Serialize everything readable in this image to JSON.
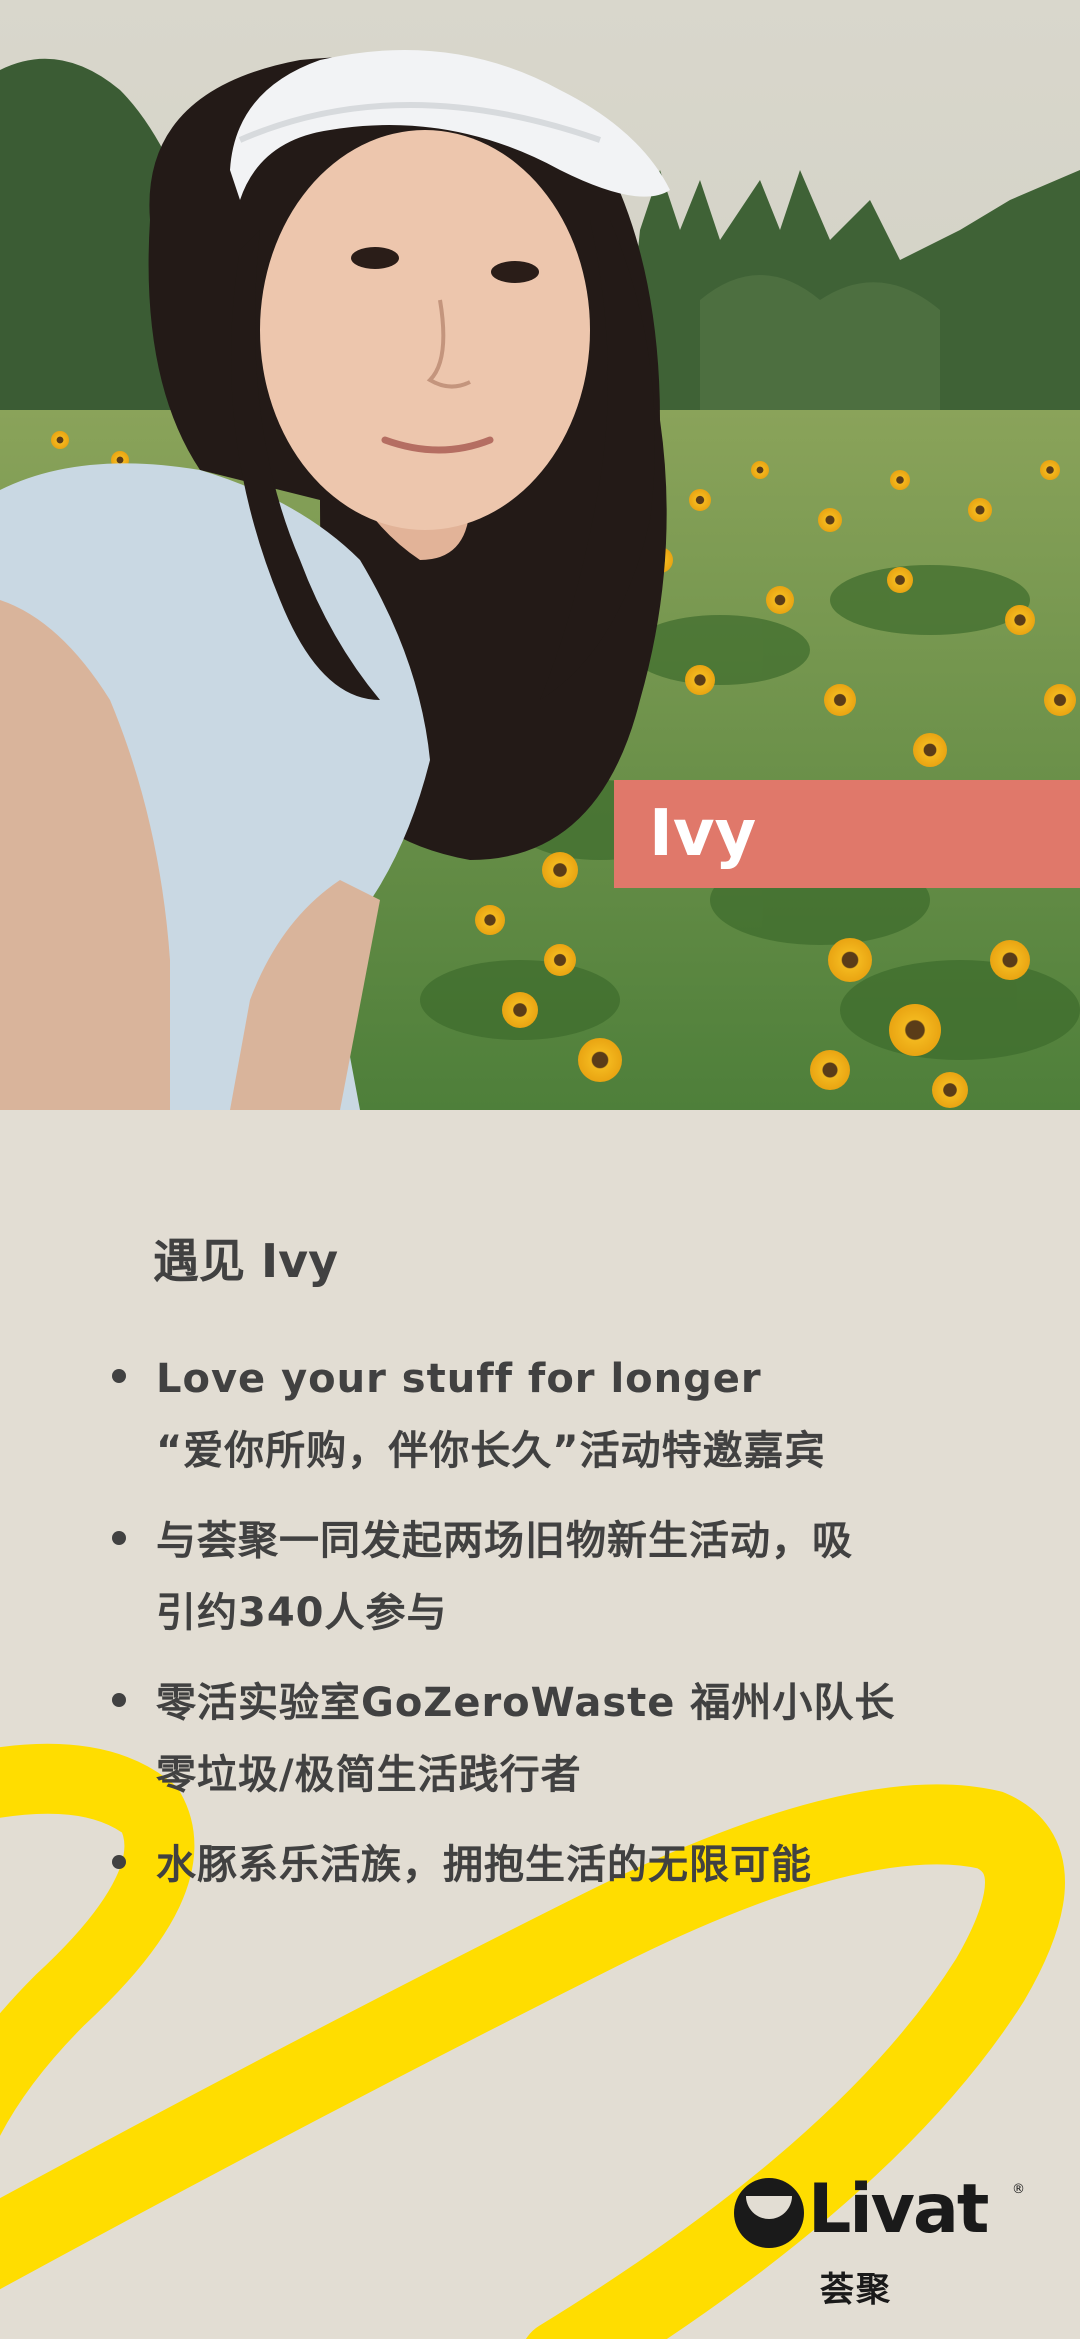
{
  "profile": {
    "name_tag": "Ivy",
    "photo_desc_icon": "portrait-photo"
  },
  "intro": {
    "heading": "遇见 Ivy",
    "bullets": [
      {
        "lines": [
          "Love your stuff for longer",
          "“爱你所购，伴你长久”活动特邀嘉宾"
        ]
      },
      {
        "lines": [
          "与荟聚一同发起两场旧物新生活动，吸",
          "引约340人参与"
        ]
      },
      {
        "lines": [
          "零活实验室GoZeroWaste 福州小队长",
          "零垃圾/极简生活践行者"
        ]
      },
      {
        "lines": [
          "水豚系乐活族，拥抱生活的无限可能"
        ]
      }
    ]
  },
  "brand": {
    "wordmark": "Livat",
    "registered": "®",
    "chinese": "荟聚"
  },
  "colors": {
    "background": "#e2ddd3",
    "name_tag": "#e0786a",
    "swoosh": "#ffdd00",
    "text": "#414141"
  }
}
